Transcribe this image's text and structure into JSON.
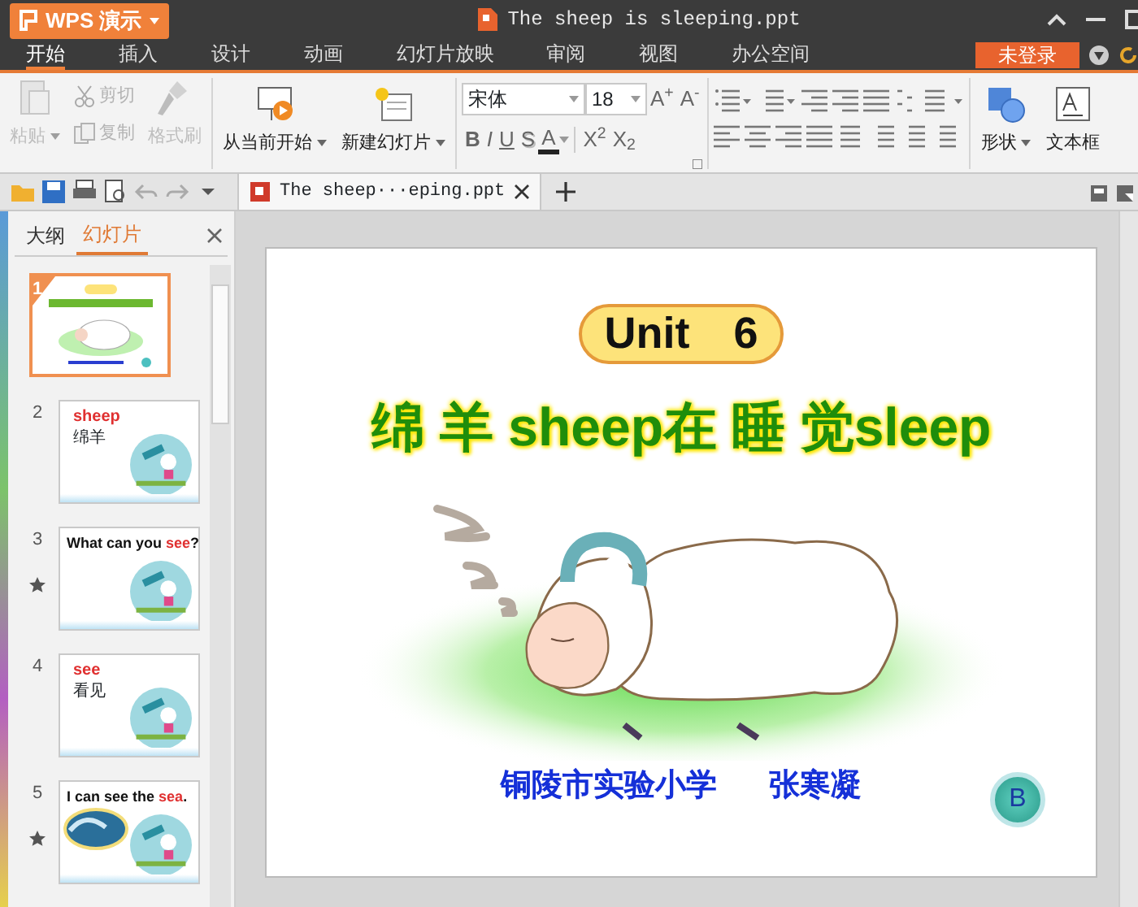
{
  "app_button": {
    "label": "WPS 演示"
  },
  "window": {
    "title": "The sheep is sleeping.ppt"
  },
  "menu_tabs": [
    {
      "label": "开始",
      "selected": true
    },
    {
      "label": "插入",
      "selected": false
    },
    {
      "label": "设计",
      "selected": false
    },
    {
      "label": "动画",
      "selected": false
    },
    {
      "label": "幻灯片放映",
      "selected": false
    },
    {
      "label": "审阅",
      "selected": false
    },
    {
      "label": "视图",
      "selected": false
    },
    {
      "label": "办公空间",
      "selected": false
    }
  ],
  "login_button": {
    "label": "未登录"
  },
  "ribbon": {
    "clipboard": [
      {
        "kind": "paste",
        "label": "粘贴",
        "disabled": true,
        "dropdown": true
      },
      {
        "kind": "cut",
        "label": "剪切",
        "disabled": true,
        "dropdown": false
      },
      {
        "kind": "copy",
        "label": "复制",
        "disabled": true,
        "dropdown": false
      },
      {
        "kind": "painter",
        "label": "格式刷",
        "disabled": true,
        "dropdown": false
      }
    ],
    "slide_buttons": [
      {
        "kind": "play",
        "label": "从当前开始",
        "dropdown": true
      },
      {
        "kind": "new",
        "label": "新建幻灯片",
        "dropdown": true
      }
    ],
    "font": {
      "name": "宋体",
      "size": "18",
      "grow": "A$^{+}$",
      "shrink": "A$^{-}$"
    },
    "format_buttons": [
      {
        "label": "B",
        "kind": "bold"
      },
      {
        "label": "I",
        "kind": "italic"
      },
      {
        "label": "U",
        "kind": "underline"
      },
      {
        "label": "S",
        "kind": "shadow"
      },
      {
        "label": "A",
        "kind": "color"
      },
      {
        "label": "X$^{2}$",
        "kind": "script"
      },
      {
        "label": "X$_{2}$",
        "kind": "script"
      }
    ],
    "insert_buttons": [
      {
        "kind": "shape",
        "label": "形状",
        "dropdown": true
      },
      {
        "kind": "textbox",
        "label": "文本框",
        "dropdown": false
      }
    ]
  },
  "document_tab": {
    "title": "The sheep···eping.ppt"
  },
  "side_panel": {
    "tabs": [
      {
        "label": "大纲",
        "selected": false
      },
      {
        "label": "幻灯片",
        "selected": true
      }
    ],
    "slides": [
      {
        "number": "1",
        "selected": true,
        "animated": false,
        "kind": "cover"
      },
      {
        "number": "2",
        "selected": false,
        "animated": false,
        "kind": "word",
        "title": "**sheep**",
        "subtitle": "绵羊"
      },
      {
        "number": "3",
        "selected": false,
        "animated": true,
        "kind": "sentence",
        "title": "What can you **see**?"
      },
      {
        "number": "4",
        "selected": false,
        "animated": false,
        "kind": "word",
        "title": "**see**",
        "subtitle": "看见"
      },
      {
        "number": "5",
        "selected": false,
        "animated": true,
        "kind": "sea",
        "title": "I can see the **sea**."
      }
    ]
  },
  "slide": {
    "unit": "Unit　6",
    "title": "绵 羊 sheep在 睡 觉sleep",
    "school": "铜陵市实验小学",
    "author": "张寒凝",
    "button": "B"
  }
}
